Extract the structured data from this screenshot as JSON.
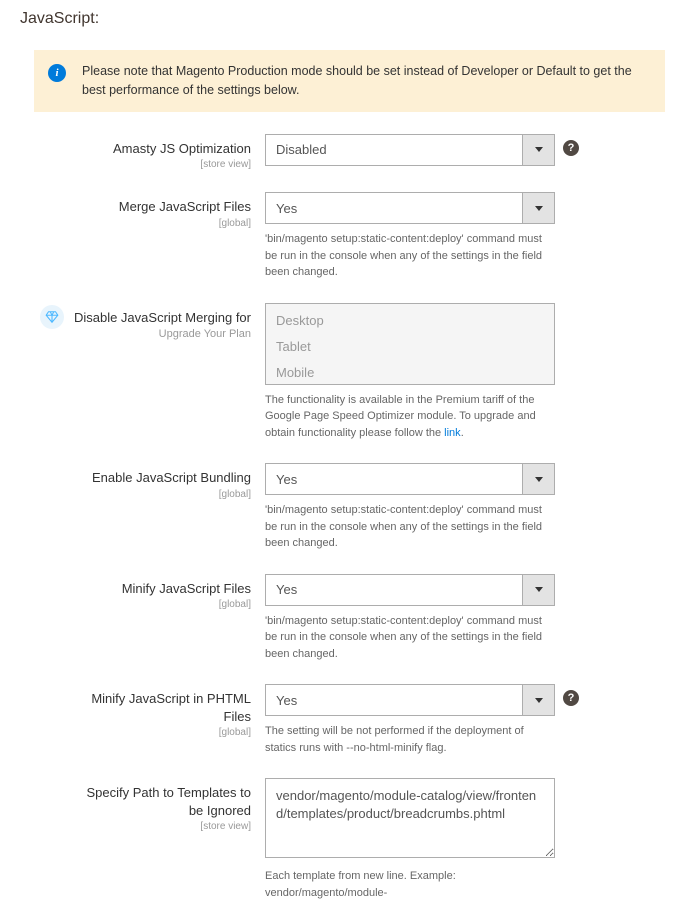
{
  "section": {
    "title": "JavaScript:"
  },
  "notice": {
    "text": "Please note that Magento Production mode should be set instead of Developer or Default to get the best performance of the settings below."
  },
  "fields": {
    "amasty_js": {
      "label": "Amasty JS Optimization",
      "scope": "[store view]",
      "value": "Disabled"
    },
    "merge_js": {
      "label": "Merge JavaScript Files",
      "scope": "[global]",
      "value": "Yes",
      "note": "'bin/magento setup:static-content:deploy' command must be run in the console when any of the settings in the field been changed."
    },
    "disable_merge": {
      "label": "Disable JavaScript Merging for",
      "upgrade": "Upgrade Your Plan",
      "placeholder_items": [
        "Desktop",
        "Tablet",
        "Mobile"
      ],
      "note_prefix": "The functionality is available in the Premium tariff of the Google Page Speed Optimizer module. To upgrade and obtain functionality please follow the ",
      "note_link": "link",
      "note_suffix": "."
    },
    "enable_bundling": {
      "label": "Enable JavaScript Bundling",
      "scope": "[global]",
      "value": "Yes",
      "note": "'bin/magento setup:static-content:deploy' command must be run in the console when any of the settings in the field been changed."
    },
    "minify_js": {
      "label": "Minify JavaScript Files",
      "scope": "[global]",
      "value": "Yes",
      "note": "'bin/magento setup:static-content:deploy' command must be run in the console when any of the settings in the field been changed."
    },
    "minify_phtml": {
      "label": "Minify JavaScript in PHTML Files",
      "scope": "[global]",
      "value": "Yes",
      "note": "The setting will be not performed if the deployment of statics runs with --no-html-minify flag."
    },
    "templates_path": {
      "label": "Specify Path to Templates to be Ignored",
      "scope": "[store view]",
      "value": "vendor/magento/module-catalog/view/frontend/templates/product/breadcrumbs.phtml",
      "note": "Each template from new line. Example: vendor/magento/module-"
    }
  }
}
